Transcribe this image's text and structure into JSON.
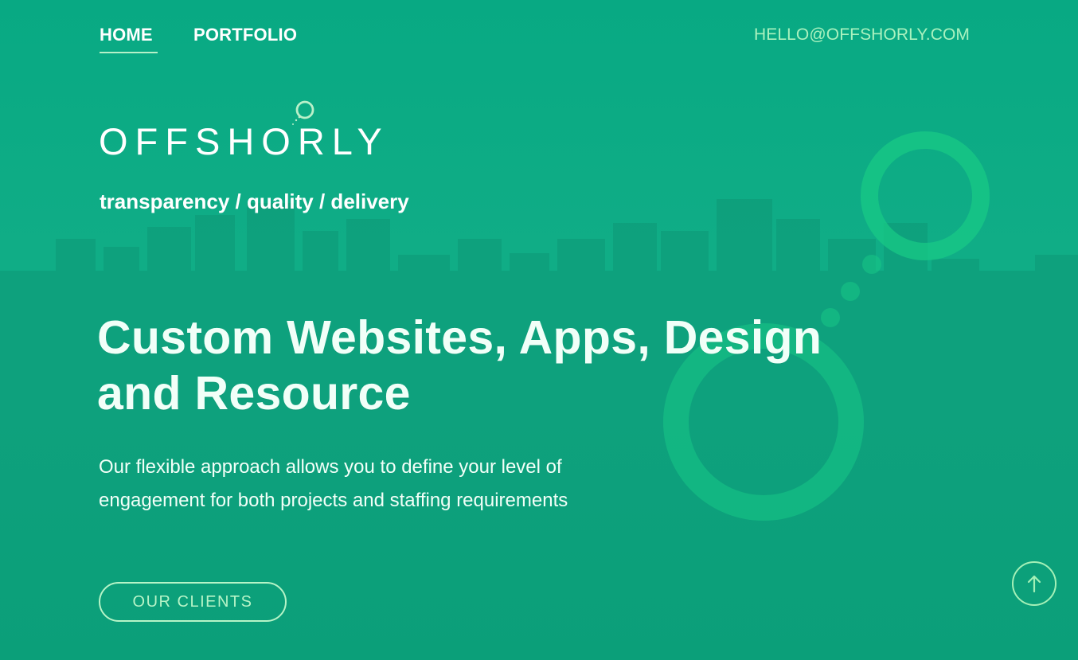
{
  "nav": {
    "home_label": "HOME",
    "portfolio_label": "PORTFOLIO",
    "email": "HELLO@OFFSHORLY.COM"
  },
  "brand": {
    "logo_text": "OFFSHORLY",
    "tagline": "transparency / quality / delivery"
  },
  "hero": {
    "headline_line_1": "Custom Websites, Apps, Design",
    "headline_line_2": "and Resource",
    "subcopy_line_1": "Our flexible approach allows you to define your level of",
    "subcopy_line_2": "engagement for both projects and staffing requirements",
    "cta_label": "OUR CLIENTS"
  },
  "icons": {
    "scroll_top": "arrow-up-icon",
    "logo_mark": "logo-o-rings-icon"
  },
  "colors": {
    "background": "#0fad86",
    "accent": "#b6f4c7",
    "email": "#aaf2bf",
    "decor": "#18c986"
  }
}
